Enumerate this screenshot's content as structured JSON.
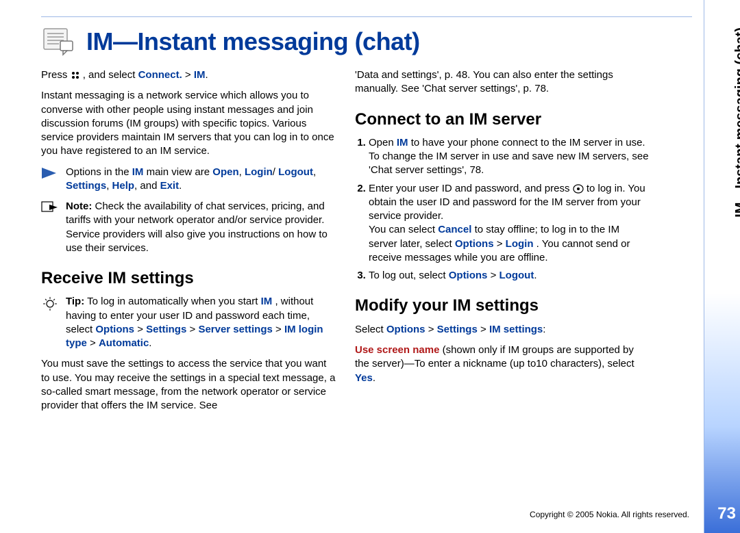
{
  "title": "IM—Instant messaging (chat)",
  "side_label": "IM—Instant messaging (chat)",
  "page_number": "73",
  "copyright": "Copyright © 2005 Nokia. All rights reserved.",
  "left": {
    "press": "Press ",
    "press_after": " , and select ",
    "connect": "Connect.",
    "gt1": " > ",
    "im": "IM",
    "intro": "Instant messaging is a network service which allows you to converse with other people using instant messages and join discussion forums (IM groups) with specific topics. Various service providers maintain IM servers that you can log in to once you have registered to an IM service.",
    "options_pre": "Options in the ",
    "options_im": "IM",
    "options_mid": " main view are ",
    "opt_open": "Open",
    "comma": ", ",
    "opt_login": "Login",
    "slash": "/",
    "opt_logout": "Logout",
    "opt_settings": "Settings",
    "opt_help": "Help",
    "and": ", and ",
    "opt_exit": "Exit",
    "period": ".",
    "note_label": "Note:",
    "note_body": " Check the availability of chat services, pricing, and tariffs with your network operator and/or service provider. Service providers will also give you instructions on how to use their services.",
    "h_receive": "Receive IM settings",
    "tip_label": "Tip:",
    "tip_a": " To log in automatically when you start ",
    "tip_im": "IM",
    "tip_b": ", without having to enter your user ID and password each time, select ",
    "tip_options": "Options",
    "tip_gt": " > ",
    "tip_settings": "Settings",
    "tip_server": "Server settings",
    "tip_imlogin": "IM login type",
    "tip_auto": "Automatic",
    "save_body": "You must save the settings to access the service that you want to use. You may receive the settings in a special text message, a so-called smart message, from the network operator or service provider that offers the IM service. See"
  },
  "right": {
    "cont": "'Data and settings', p. 48. You can also enter the settings manually. See 'Chat server settings', p. 78.",
    "h_connect": "Connect to an IM server",
    "s1a": "Open ",
    "s1_im": "IM",
    "s1b": " to have your phone connect to the IM server in use. To change the IM server in use and save new IM servers, see 'Chat server settings', 78.",
    "s2a": "Enter your user ID and password, and press ",
    "s2b": " to log in. You obtain the user ID and password for the IM server from your service provider.",
    "s2c": "You can select ",
    "s2_cancel": "Cancel",
    "s2d": " to stay offline; to log in to the IM server later, select ",
    "s2_options": "Options",
    "s2_gt": " > ",
    "s2_login": "Login",
    "s2e": ". You cannot send or receive messages while you are offline.",
    "s3a": "To log out, select ",
    "s3_options": "Options",
    "s3_gt": " > ",
    "s3_logout": "Logout",
    "h_modify": "Modify your IM settings",
    "mod_a": "Select ",
    "mod_options": "Options",
    "mod_gt": " > ",
    "mod_settings": "Settings",
    "mod_imset": "IM settings",
    "colon": ":",
    "use_name": "Use screen name",
    "use_body": " (shown only if IM groups are supported by the server)—To enter a nickname (up to10 characters), select ",
    "yes": "Yes",
    "dot": "."
  }
}
